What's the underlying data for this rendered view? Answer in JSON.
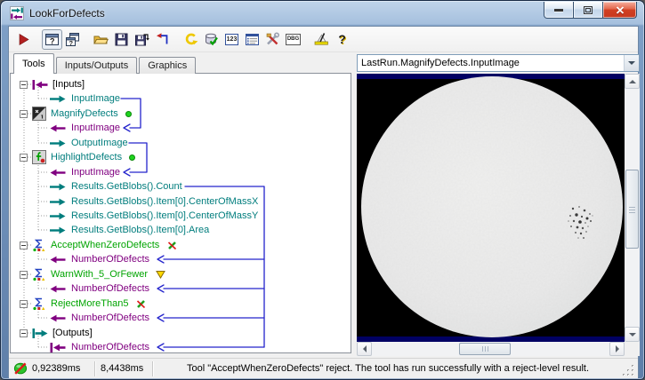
{
  "window": {
    "title": "LookForDefects",
    "controls": {
      "minimize": "minimize",
      "maximize": "maximize",
      "close": "close"
    }
  },
  "toolbar": {
    "buttons": [
      {
        "name": "run"
      },
      {
        "name": "show-image-window",
        "pressed": true
      },
      {
        "name": "cascade-windows"
      },
      {
        "name": "open"
      },
      {
        "name": "save"
      },
      {
        "name": "save-as"
      },
      {
        "name": "revert"
      },
      {
        "name": "undo"
      },
      {
        "name": "database-validate"
      },
      {
        "name": "posted-values"
      },
      {
        "name": "properties-form"
      },
      {
        "name": "customize-tools"
      },
      {
        "name": "debug"
      },
      {
        "name": "annotate"
      },
      {
        "name": "help"
      }
    ],
    "glyphs": {
      "window_q": "?",
      "num": "123",
      "dbg": "DBG",
      "help": "?"
    }
  },
  "tabs": [
    {
      "label": "Tools",
      "active": true
    },
    {
      "label": "Inputs/Outputs",
      "active": false
    },
    {
      "label": "Graphics",
      "active": false
    }
  ],
  "tree": {
    "items": [
      {
        "label": "[Inputs]",
        "kind": "input-terminal",
        "icon": "inputs-terminal-icon",
        "color": "black"
      },
      {
        "label": "InputImage",
        "kind": "output-pin",
        "icon": "output-arrow-icon",
        "color": "teal"
      },
      {
        "label": "MagnifyDefects",
        "kind": "tool",
        "icon": "image-tool-icon",
        "color": "teal",
        "status": "ok"
      },
      {
        "label": "InputImage",
        "kind": "input-pin",
        "icon": "input-arrow-icon",
        "color": "purple"
      },
      {
        "label": "OutputImage",
        "kind": "output-pin",
        "icon": "output-arrow-icon",
        "color": "teal"
      },
      {
        "label": "HighlightDefects",
        "kind": "tool",
        "icon": "script-tool-icon",
        "color": "teal",
        "status": "ok"
      },
      {
        "label": "InputImage",
        "kind": "input-pin",
        "icon": "input-arrow-icon",
        "color": "purple"
      },
      {
        "label": "Results.GetBlobs().Count",
        "kind": "output-pin",
        "icon": "output-arrow-icon",
        "color": "teal"
      },
      {
        "label": "Results.GetBlobs().Item[0].CenterOfMassX",
        "kind": "output-pin",
        "icon": "output-arrow-icon",
        "color": "teal"
      },
      {
        "label": "Results.GetBlobs().Item[0].CenterOfMassY",
        "kind": "output-pin",
        "icon": "output-arrow-icon",
        "color": "teal"
      },
      {
        "label": "Results.GetBlobs().Item[0].Area",
        "kind": "output-pin",
        "icon": "output-arrow-icon",
        "color": "teal"
      },
      {
        "label": "AcceptWhenZeroDefects",
        "kind": "tool",
        "icon": "sigma-tool-icon",
        "color": "green",
        "status": "reject"
      },
      {
        "label": "NumberOfDefects",
        "kind": "input-pin",
        "icon": "input-arrow-icon",
        "color": "purple"
      },
      {
        "label": "WarnWith_5_OrFewer",
        "kind": "tool",
        "icon": "sigma-tool-icon",
        "color": "green",
        "status": "warn"
      },
      {
        "label": "NumberOfDefects",
        "kind": "input-pin",
        "icon": "input-arrow-icon",
        "color": "purple"
      },
      {
        "label": "RejectMoreThan5",
        "kind": "tool",
        "icon": "sigma-tool-icon",
        "color": "green",
        "status": "reject"
      },
      {
        "label": "NumberOfDefects",
        "kind": "input-pin",
        "icon": "input-arrow-icon",
        "color": "purple"
      },
      {
        "label": "[Outputs]",
        "kind": "output-terminal",
        "icon": "outputs-terminal-icon",
        "color": "black"
      },
      {
        "label": "NumberOfDefects",
        "kind": "input-pin",
        "icon": "input-terminal-arrow-icon",
        "color": "purple"
      }
    ]
  },
  "image_panel": {
    "source_selector": "LastRun.MagnifyDefects.InputImage",
    "content": "gray circular part on black background with dark defect-speckle cluster at right-center"
  },
  "status_bar": {
    "result_icon": "reject-indicator",
    "time_1": "0,92389ms",
    "time_2": "8,4438ms",
    "message": "Tool \"AcceptWhenZeroDefects\" reject. The tool has run successfully with a reject-level result."
  },
  "colors": {
    "output_pin_teal": "#007d7d",
    "input_pin_purple": "#800080",
    "tool_green": "#00a400",
    "connector_blue": "#2424cc",
    "image_border_navy": "#000063",
    "close_button_red": "#d13f22"
  }
}
